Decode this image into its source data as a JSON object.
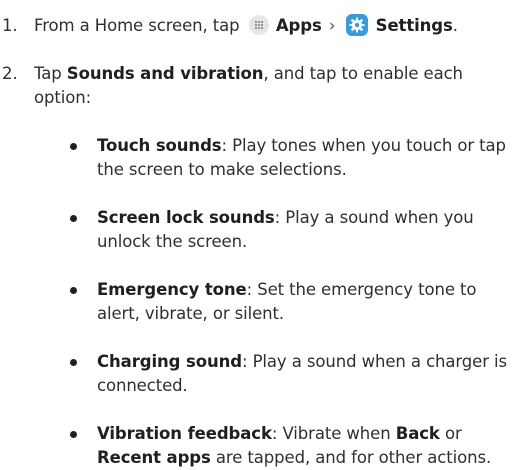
{
  "steps": [
    {
      "number": "1.",
      "prefix": "From a Home screen, tap",
      "apps_label": "Apps",
      "separator": "›",
      "settings_label": "Settings",
      "suffix": "."
    },
    {
      "number": "2.",
      "prefix": "Tap",
      "bold": "Sounds and vibration",
      "suffix": ", and tap to enable each option:"
    }
  ],
  "options": [
    {
      "title": "Touch sounds",
      "description": ": Play tones when you touch or tap the screen to make selections."
    },
    {
      "title": "Screen lock sounds",
      "description": ": Play a sound when you unlock the screen."
    },
    {
      "title": "Emergency tone",
      "description": ": Set the emergency tone to alert, vibrate, or silent."
    },
    {
      "title": "Charging sound",
      "description": ": Play a sound when a charger is connected."
    }
  ],
  "vibration": {
    "title": "Vibration feedback",
    "text1": ": Vibrate when",
    "back": "Back",
    "text2": "or",
    "recent": "Recent apps",
    "text3": "are tapped, and for other actions."
  },
  "colors": {
    "text": "#2f2f2f",
    "settings_icon": "#3b9ad9",
    "apps_icon": "#e6e6e6"
  },
  "icons": [
    "apps-icon",
    "settings-icon"
  ]
}
